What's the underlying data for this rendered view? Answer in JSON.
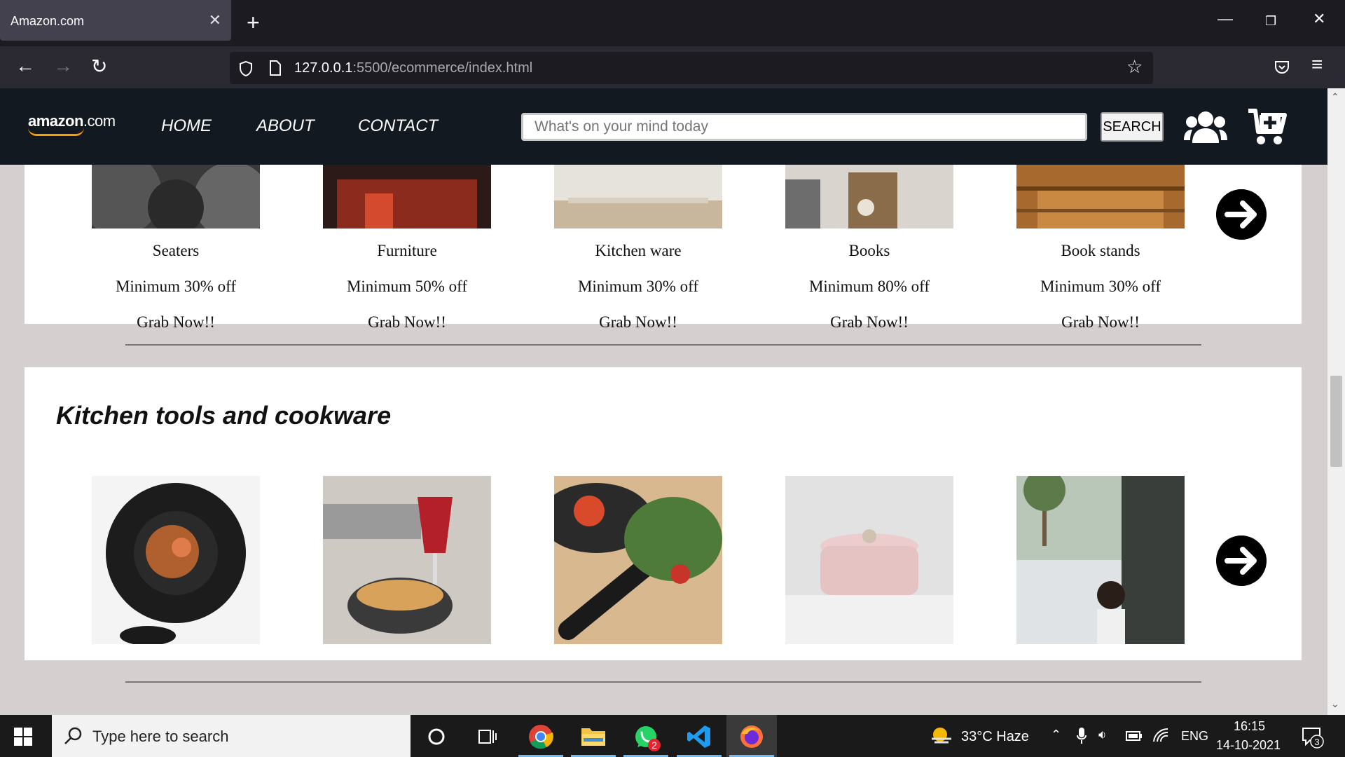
{
  "browser": {
    "tab_title": "Amazon.com",
    "url_host": "127.0.0.1",
    "url_path": ":5500/ecommerce/index.html"
  },
  "header": {
    "logo_main": "amazon",
    "logo_suffix": ".com",
    "nav": [
      "HOME",
      "ABOUT",
      "CONTACT"
    ],
    "search_placeholder": "What's on your mind today",
    "search_button": "SEARCH"
  },
  "deals": {
    "items": [
      {
        "name": "Seaters",
        "discount": "Minimum 30% off",
        "cta": "Grab Now!!"
      },
      {
        "name": "Furniture",
        "discount": "Minimum 50% off",
        "cta": "Grab Now!!"
      },
      {
        "name": "Kitchen ware",
        "discount": "Minimum 30% off",
        "cta": "Grab Now!!"
      },
      {
        "name": "Books",
        "discount": "Minimum 80% off",
        "cta": "Grab Now!!"
      },
      {
        "name": "Book stands",
        "discount": "Minimum 30% off",
        "cta": "Grab Now!!"
      }
    ]
  },
  "kitchen": {
    "title": "Kitchen tools and cookware"
  },
  "taskbar": {
    "search_placeholder": "Type here to search",
    "whatsapp_badge": "2",
    "weather": "33°C  Haze",
    "language": "ENG",
    "time": "16:15",
    "date": "14-10-2021",
    "notifications": "3"
  },
  "colors": {
    "site_header": "#131921",
    "page_bg": "#d5cfcf",
    "browser_bg": "#1c1b22"
  }
}
